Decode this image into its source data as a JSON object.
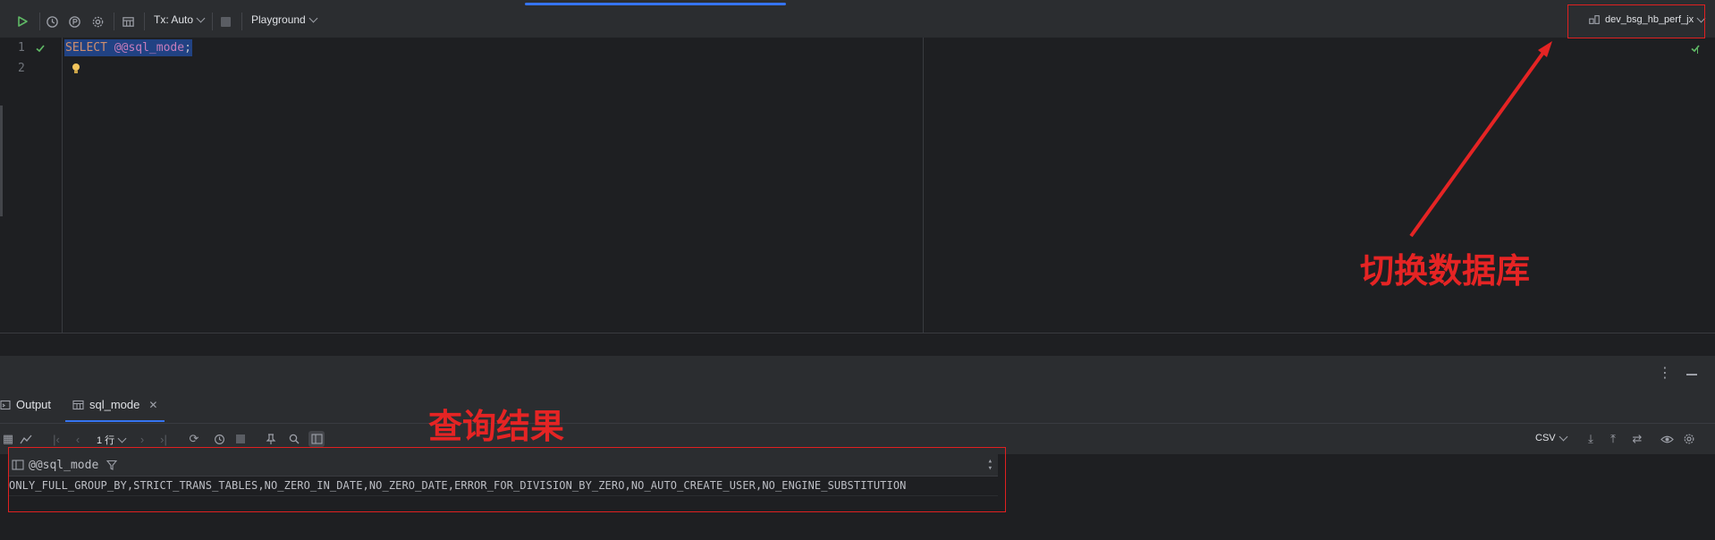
{
  "toolbar": {
    "tx_label": "Tx: Auto",
    "playground_label": "Playground",
    "datasource_label": "dev_bsg_hb_perf_jx"
  },
  "editor": {
    "line_numbers": [
      "1",
      "2"
    ],
    "code": {
      "keyword": "SELECT",
      "variable": "@@sql_mode",
      "punct": ";"
    }
  },
  "results": {
    "tabs": [
      {
        "label": "Output",
        "icon": "console-icon"
      },
      {
        "label": "sql_mode",
        "icon": "table-icon",
        "closable": true
      }
    ],
    "row_count_label": "1 行",
    "export_format": "CSV",
    "column_header": "@@sql_mode",
    "cell_value": "ONLY_FULL_GROUP_BY,STRICT_TRANS_TABLES,NO_ZERO_IN_DATE,NO_ZERO_DATE,ERROR_FOR_DIVISION_BY_ZERO,NO_AUTO_CREATE_USER,NO_ENGINE_SUBSTITUTION"
  },
  "annotations": {
    "switch_db": "切换数据库",
    "query_result": "查询结果"
  },
  "colors": {
    "annotation": "#e52424",
    "accent": "#3574f0",
    "run_green": "#5fb865",
    "background": "#1e1f22"
  }
}
